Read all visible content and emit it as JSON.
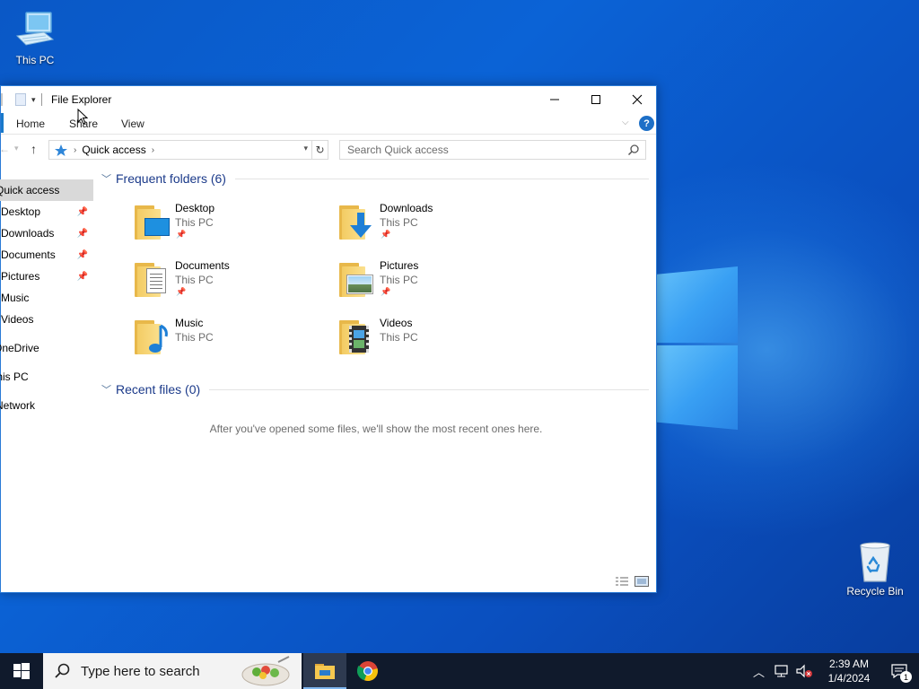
{
  "desktop": {
    "icons": [
      {
        "label": "This PC",
        "icon": "this-pc-icon"
      },
      {
        "label": "Recycle Bin",
        "icon": "recycle-bin-icon"
      }
    ]
  },
  "window": {
    "title": "File Explorer",
    "ribbon_tabs": [
      "Home",
      "Share",
      "View"
    ],
    "address": {
      "location": "Quick access"
    },
    "search": {
      "placeholder": "Search Quick access"
    }
  },
  "navpane": {
    "items": [
      {
        "label": "Quick access",
        "pinned": false
      },
      {
        "label": "Desktop",
        "pinned": true
      },
      {
        "label": "Downloads",
        "pinned": true
      },
      {
        "label": "Documents",
        "pinned": true
      },
      {
        "label": "Pictures",
        "pinned": true
      },
      {
        "label": "Music",
        "pinned": false
      },
      {
        "label": "Videos",
        "pinned": false
      },
      {
        "label": "OneDrive",
        "pinned": false
      },
      {
        "label": "This PC",
        "pinned": false
      },
      {
        "label": "Network",
        "pinned": false
      }
    ]
  },
  "content": {
    "frequent_header": "Frequent folders (6)",
    "recent_header": "Recent files (0)",
    "empty_message": "After you've opened some files, we'll show the most recent ones here.",
    "folders": [
      {
        "name": "Desktop",
        "location": "This PC",
        "pinned": true,
        "overlay": "desktop"
      },
      {
        "name": "Downloads",
        "location": "This PC",
        "pinned": true,
        "overlay": "download-arrow"
      },
      {
        "name": "Documents",
        "location": "This PC",
        "pinned": true,
        "overlay": "document"
      },
      {
        "name": "Pictures",
        "location": "This PC",
        "pinned": true,
        "overlay": "picture"
      },
      {
        "name": "Music",
        "location": "This PC",
        "pinned": false,
        "overlay": "music-note"
      },
      {
        "name": "Videos",
        "location": "This PC",
        "pinned": false,
        "overlay": "film"
      }
    ]
  },
  "taskbar": {
    "search_placeholder": "Type here to search",
    "clock": {
      "time": "2:39 AM",
      "date": "1/4/2024"
    },
    "notification_count": "1"
  },
  "colors": {
    "accent": "#1979ca",
    "taskbar": "#101a2c",
    "group_header": "#1b3a8a"
  }
}
